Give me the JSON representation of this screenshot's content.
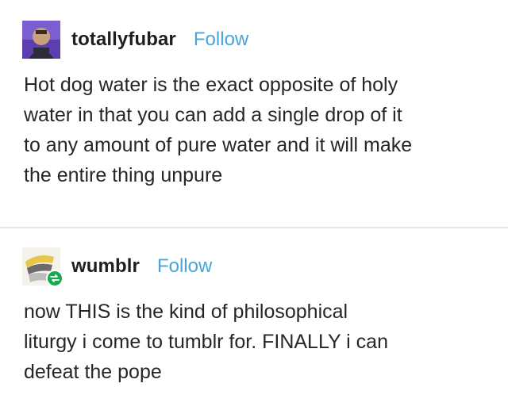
{
  "posts": [
    {
      "username": "totallyfubar",
      "follow_label": "Follow",
      "avatar_icon": "user-avatar-icon",
      "text": "Hot dog water is the exact opposite of holy\nwater in that you can add a single drop of it\nto any amount of pure water and it will make\nthe entire thing unpure"
    },
    {
      "username": "wumblr",
      "follow_label": "Follow",
      "avatar_icon": "user-avatar-icon",
      "badge_icon": "reblog-icon",
      "text": "now THIS is the kind of philosophical\nliturgy i come to tumblr for. FINALLY i can\ndefeat the pope"
    }
  ],
  "colors": {
    "follow": "#46a6d8",
    "reblog_badge": "#1aa84f",
    "divider": "#e6e6e6"
  }
}
